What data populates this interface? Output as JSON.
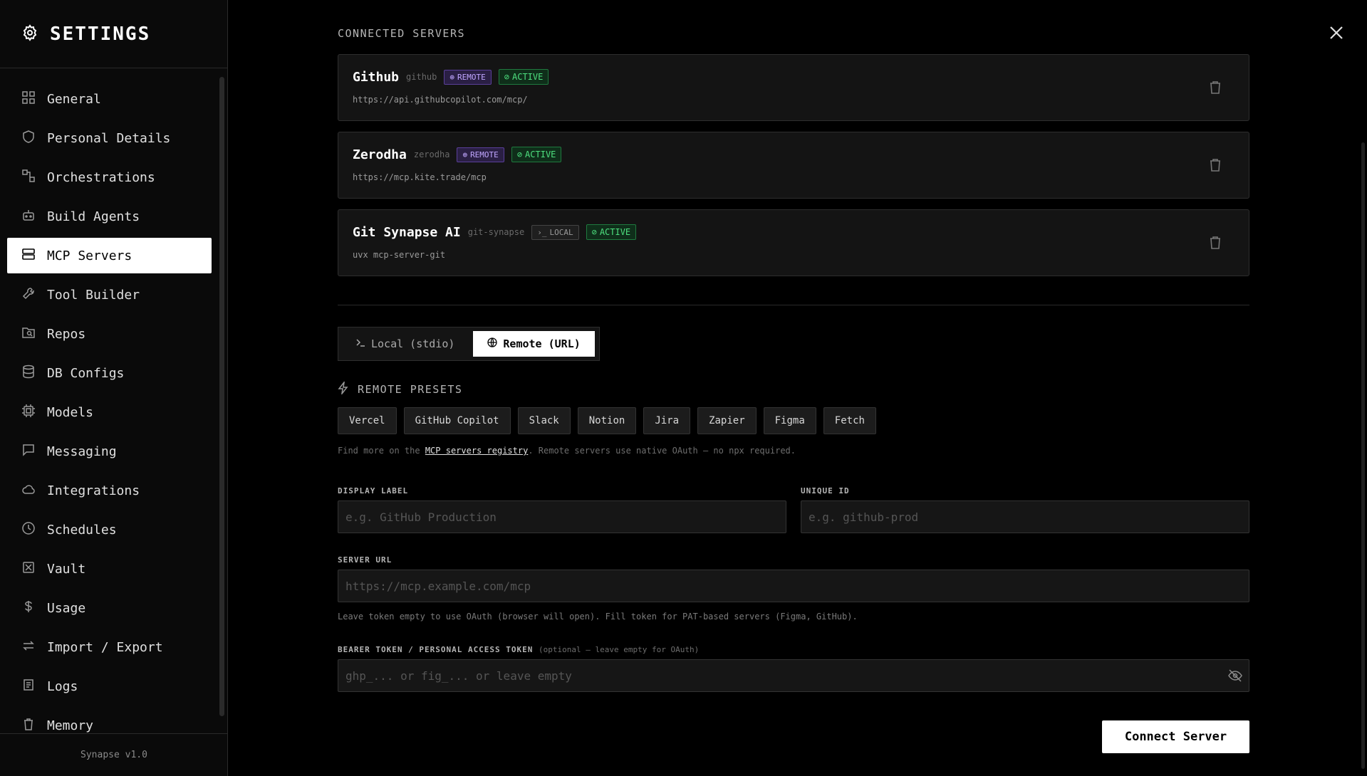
{
  "sidebar": {
    "title": "SETTINGS",
    "items": [
      {
        "label": "General",
        "icon": "grid-icon",
        "active": false
      },
      {
        "label": "Personal Details",
        "icon": "shield-icon",
        "active": false
      },
      {
        "label": "Orchestrations",
        "icon": "workflow-icon",
        "active": false
      },
      {
        "label": "Build Agents",
        "icon": "bot-icon",
        "active": false
      },
      {
        "label": "MCP Servers",
        "icon": "server-icon",
        "active": true
      },
      {
        "label": "Tool Builder",
        "icon": "wrench-icon",
        "active": false
      },
      {
        "label": "Repos",
        "icon": "folder-search-icon",
        "active": false
      },
      {
        "label": "DB Configs",
        "icon": "database-icon",
        "active": false
      },
      {
        "label": "Models",
        "icon": "cpu-icon",
        "active": false
      },
      {
        "label": "Messaging",
        "icon": "message-icon",
        "active": false
      },
      {
        "label": "Integrations",
        "icon": "cloud-icon",
        "active": false
      },
      {
        "label": "Schedules",
        "icon": "clock-icon",
        "active": false
      },
      {
        "label": "Vault",
        "icon": "vault-icon",
        "active": false
      },
      {
        "label": "Usage",
        "icon": "dollar-icon",
        "active": false
      },
      {
        "label": "Import / Export",
        "icon": "arrows-icon",
        "active": false
      },
      {
        "label": "Logs",
        "icon": "logs-icon",
        "active": false
      },
      {
        "label": "Memory",
        "icon": "trash-icon",
        "active": false
      }
    ],
    "footer": "Synapse v1.0"
  },
  "connected": {
    "title": "CONNECTED SERVERS",
    "servers": [
      {
        "name": "Github",
        "id": "github",
        "type": "REMOTE",
        "status": "ACTIVE",
        "url": "https://api.githubcopilot.com/mcp/"
      },
      {
        "name": "Zerodha",
        "id": "zerodha",
        "type": "REMOTE",
        "status": "ACTIVE",
        "url": "https://mcp.kite.trade/mcp"
      },
      {
        "name": "Git Synapse AI",
        "id": "git-synapse",
        "type": "LOCAL",
        "status": "ACTIVE",
        "url": "uvx mcp-server-git"
      }
    ]
  },
  "mode_toggle": {
    "local_label": "Local (stdio)",
    "remote_label": "Remote (URL)",
    "selected": "remote"
  },
  "presets": {
    "title": "REMOTE PRESETS",
    "items": [
      "Vercel",
      "GitHub Copilot",
      "Slack",
      "Notion",
      "Jira",
      "Zapier",
      "Figma",
      "Fetch"
    ],
    "hint_prefix": "Find more on the ",
    "hint_link": "MCP servers registry",
    "hint_suffix": ". Remote servers use native OAuth — no npx required."
  },
  "form": {
    "display_label": {
      "label": "DISPLAY LABEL",
      "placeholder": "e.g. GitHub Production",
      "value": ""
    },
    "unique_id": {
      "label": "UNIQUE ID",
      "placeholder": "e.g. github-prod",
      "value": ""
    },
    "server_url": {
      "label": "SERVER URL",
      "placeholder": "https://mcp.example.com/mcp",
      "value": ""
    },
    "token_hint": "Leave token empty to use OAuth (browser will open). Fill token for PAT-based servers (Figma, GitHub).",
    "token": {
      "label": "BEARER TOKEN / PERSONAL ACCESS TOKEN",
      "label_optional": "(optional — leave empty for OAuth)",
      "placeholder": "ghp_... or fig_... or leave empty",
      "value": ""
    },
    "submit_label": "Connect Server"
  }
}
